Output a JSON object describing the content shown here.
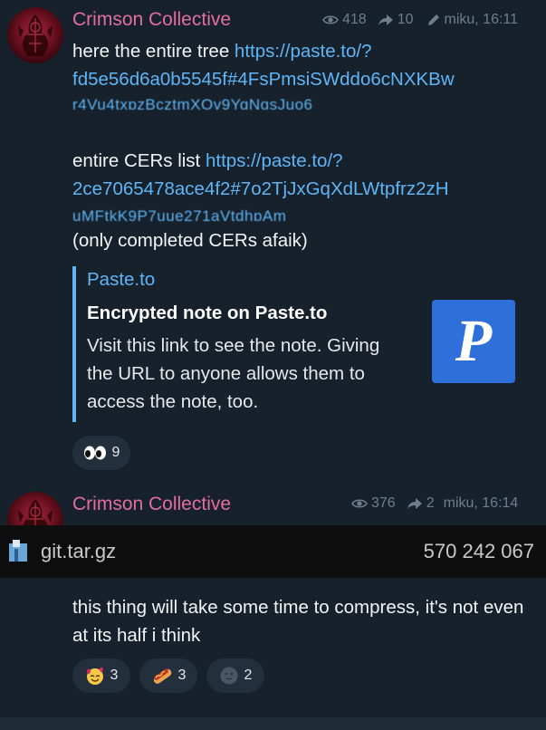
{
  "messages": [
    {
      "author": "Crimson Collective",
      "views": "418",
      "forwards": "10",
      "signature": "miku, 16:11",
      "lines": {
        "l1_text": "here the entire tree ",
        "l1_link": "https://paste.to/?",
        "l2_link": "fd5e56d6a0b5545f#4FsPmsiSWddo6cNXKBw",
        "l3_link_blurred": "r4Vu4txpzBcztmXOv9YqNgsJuo6",
        "l5_text": "entire CERs list ",
        "l5_link": "https://paste.to/?",
        "l6_link": "2ce7065478ace4f2#7o2TjJxGqXdLWtpfrz2zH",
        "l7_link_blurred": "uMFtkK9P7uue271aVtdhpAm",
        "l8_text": "(only completed CERs afaik)"
      },
      "preview": {
        "site": "Paste.to",
        "title": "Encrypted note on Paste.to",
        "description": "Visit this link to see the note. Giving the URL to anyone allows them to access the note, too.",
        "thumb_letter": "P",
        "thumb_color": "#2f6fd9"
      },
      "reactions": [
        {
          "emoji": "eyes-icon",
          "count": "9"
        }
      ]
    },
    {
      "author": "Crimson Collective",
      "views": "376",
      "forwards": "2",
      "signature": "miku, 16:14",
      "file": {
        "name": "git.tar.gz",
        "size": "570 242 067"
      },
      "text": "this thing will take some time to compress, it's not even at its half i think",
      "reactions": [
        {
          "emoji": "smiling-face-with-hearts-icon",
          "count": "3"
        },
        {
          "emoji": "hot-dog-icon",
          "count": "3"
        },
        {
          "emoji": "new-moon-face-icon",
          "count": "2"
        }
      ]
    }
  ],
  "colors": {
    "background": "#17212b",
    "author": "#e26ea0",
    "link": "#5eb5f7",
    "meta": "#6d7f8f"
  }
}
